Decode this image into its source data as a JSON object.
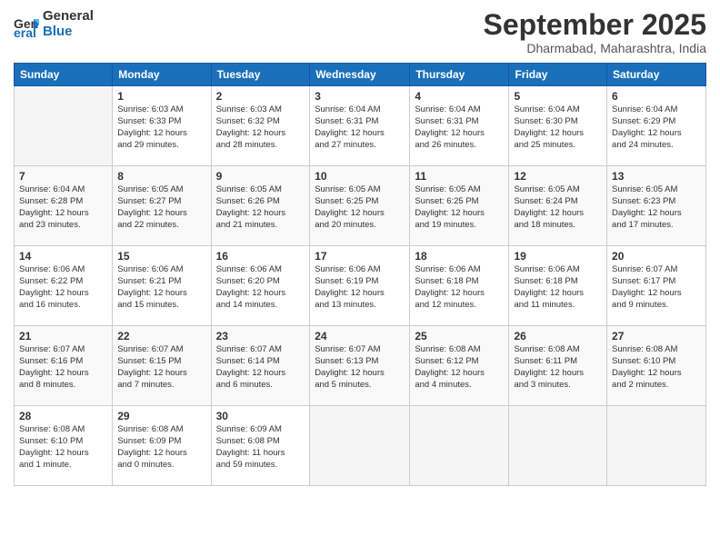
{
  "logo": {
    "line1": "General",
    "line2": "Blue"
  },
  "title": "September 2025",
  "subtitle": "Dharmabad, Maharashtra, India",
  "days_header": [
    "Sunday",
    "Monday",
    "Tuesday",
    "Wednesday",
    "Thursday",
    "Friday",
    "Saturday"
  ],
  "weeks": [
    [
      {
        "num": "",
        "info": ""
      },
      {
        "num": "1",
        "info": "Sunrise: 6:03 AM\nSunset: 6:33 PM\nDaylight: 12 hours\nand 29 minutes."
      },
      {
        "num": "2",
        "info": "Sunrise: 6:03 AM\nSunset: 6:32 PM\nDaylight: 12 hours\nand 28 minutes."
      },
      {
        "num": "3",
        "info": "Sunrise: 6:04 AM\nSunset: 6:31 PM\nDaylight: 12 hours\nand 27 minutes."
      },
      {
        "num": "4",
        "info": "Sunrise: 6:04 AM\nSunset: 6:31 PM\nDaylight: 12 hours\nand 26 minutes."
      },
      {
        "num": "5",
        "info": "Sunrise: 6:04 AM\nSunset: 6:30 PM\nDaylight: 12 hours\nand 25 minutes."
      },
      {
        "num": "6",
        "info": "Sunrise: 6:04 AM\nSunset: 6:29 PM\nDaylight: 12 hours\nand 24 minutes."
      }
    ],
    [
      {
        "num": "7",
        "info": "Sunrise: 6:04 AM\nSunset: 6:28 PM\nDaylight: 12 hours\nand 23 minutes."
      },
      {
        "num": "8",
        "info": "Sunrise: 6:05 AM\nSunset: 6:27 PM\nDaylight: 12 hours\nand 22 minutes."
      },
      {
        "num": "9",
        "info": "Sunrise: 6:05 AM\nSunset: 6:26 PM\nDaylight: 12 hours\nand 21 minutes."
      },
      {
        "num": "10",
        "info": "Sunrise: 6:05 AM\nSunset: 6:25 PM\nDaylight: 12 hours\nand 20 minutes."
      },
      {
        "num": "11",
        "info": "Sunrise: 6:05 AM\nSunset: 6:25 PM\nDaylight: 12 hours\nand 19 minutes."
      },
      {
        "num": "12",
        "info": "Sunrise: 6:05 AM\nSunset: 6:24 PM\nDaylight: 12 hours\nand 18 minutes."
      },
      {
        "num": "13",
        "info": "Sunrise: 6:05 AM\nSunset: 6:23 PM\nDaylight: 12 hours\nand 17 minutes."
      }
    ],
    [
      {
        "num": "14",
        "info": "Sunrise: 6:06 AM\nSunset: 6:22 PM\nDaylight: 12 hours\nand 16 minutes."
      },
      {
        "num": "15",
        "info": "Sunrise: 6:06 AM\nSunset: 6:21 PM\nDaylight: 12 hours\nand 15 minutes."
      },
      {
        "num": "16",
        "info": "Sunrise: 6:06 AM\nSunset: 6:20 PM\nDaylight: 12 hours\nand 14 minutes."
      },
      {
        "num": "17",
        "info": "Sunrise: 6:06 AM\nSunset: 6:19 PM\nDaylight: 12 hours\nand 13 minutes."
      },
      {
        "num": "18",
        "info": "Sunrise: 6:06 AM\nSunset: 6:18 PM\nDaylight: 12 hours\nand 12 minutes."
      },
      {
        "num": "19",
        "info": "Sunrise: 6:06 AM\nSunset: 6:18 PM\nDaylight: 12 hours\nand 11 minutes."
      },
      {
        "num": "20",
        "info": "Sunrise: 6:07 AM\nSunset: 6:17 PM\nDaylight: 12 hours\nand 9 minutes."
      }
    ],
    [
      {
        "num": "21",
        "info": "Sunrise: 6:07 AM\nSunset: 6:16 PM\nDaylight: 12 hours\nand 8 minutes."
      },
      {
        "num": "22",
        "info": "Sunrise: 6:07 AM\nSunset: 6:15 PM\nDaylight: 12 hours\nand 7 minutes."
      },
      {
        "num": "23",
        "info": "Sunrise: 6:07 AM\nSunset: 6:14 PM\nDaylight: 12 hours\nand 6 minutes."
      },
      {
        "num": "24",
        "info": "Sunrise: 6:07 AM\nSunset: 6:13 PM\nDaylight: 12 hours\nand 5 minutes."
      },
      {
        "num": "25",
        "info": "Sunrise: 6:08 AM\nSunset: 6:12 PM\nDaylight: 12 hours\nand 4 minutes."
      },
      {
        "num": "26",
        "info": "Sunrise: 6:08 AM\nSunset: 6:11 PM\nDaylight: 12 hours\nand 3 minutes."
      },
      {
        "num": "27",
        "info": "Sunrise: 6:08 AM\nSunset: 6:10 PM\nDaylight: 12 hours\nand 2 minutes."
      }
    ],
    [
      {
        "num": "28",
        "info": "Sunrise: 6:08 AM\nSunset: 6:10 PM\nDaylight: 12 hours\nand 1 minute."
      },
      {
        "num": "29",
        "info": "Sunrise: 6:08 AM\nSunset: 6:09 PM\nDaylight: 12 hours\nand 0 minutes."
      },
      {
        "num": "30",
        "info": "Sunrise: 6:09 AM\nSunset: 6:08 PM\nDaylight: 11 hours\nand 59 minutes."
      },
      {
        "num": "",
        "info": ""
      },
      {
        "num": "",
        "info": ""
      },
      {
        "num": "",
        "info": ""
      },
      {
        "num": "",
        "info": ""
      }
    ]
  ]
}
